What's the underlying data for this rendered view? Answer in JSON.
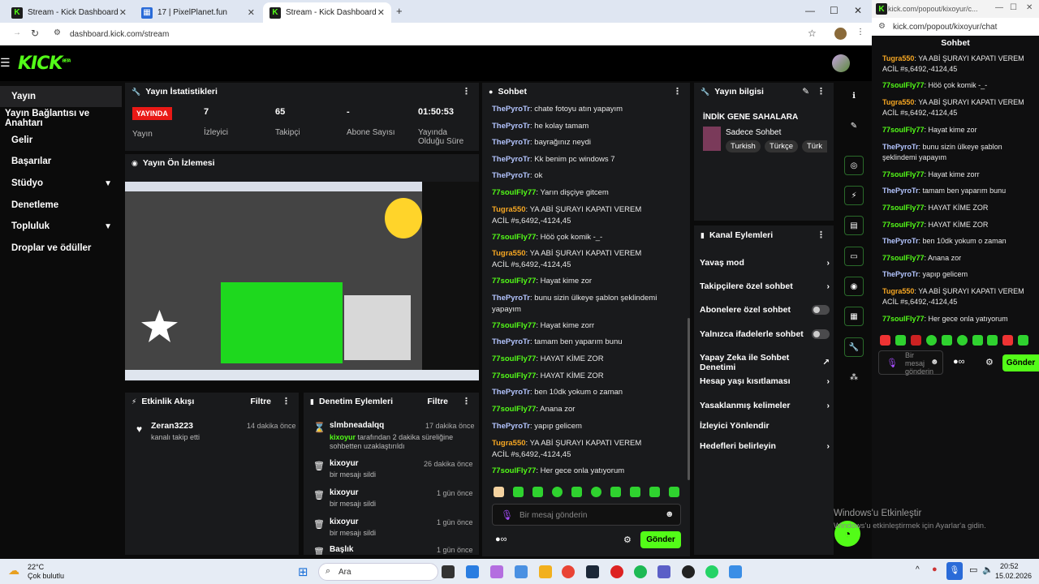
{
  "browser": {
    "tabs": [
      "Stream - Kick Dashboard",
      "17 | PixelPlanet.fun",
      "Stream - Kick Dashboard"
    ],
    "new_tab": "+",
    "url": "dashboard.kick.com/stream",
    "window_controls": [
      "—",
      "☐",
      "✕"
    ]
  },
  "header": {
    "logo": "KICK",
    "logo_sup": "BETA"
  },
  "sidebar": {
    "items": [
      {
        "label": "Yayın"
      },
      {
        "label": "Yayın Bağlantısı ve Anahtarı"
      },
      {
        "label": "Gelir"
      },
      {
        "label": "Başarılar"
      },
      {
        "label": "Stüdyo"
      },
      {
        "label": "Denetleme"
      },
      {
        "label": "Topluluk"
      },
      {
        "label": "Droplar ve ödüller"
      }
    ]
  },
  "stats": {
    "title": "Yayın İstatistikleri",
    "live": "YAYINDA",
    "stream_label": "Yayın",
    "viewers_value": "7",
    "viewers_label": "İzleyici",
    "followers_value": "65",
    "followers_label": "Takipçi",
    "subs_value": "-",
    "subs_label": "Abone Sayısı",
    "uptime_value": "01:50:53",
    "uptime_label": "Yayında Olduğu Süre"
  },
  "preview": {
    "title": "Yayın Ön İzlemesi"
  },
  "activity": {
    "title": "Etkinlik Akışı",
    "filter": "Filtre",
    "item": {
      "user": "Zeran3223",
      "time": "14 dakika önce",
      "text": "kanalı takip etti"
    }
  },
  "moderation": {
    "title": "Denetim Eylemleri",
    "filter": "Filtre",
    "items": [
      {
        "user": "slmbneadalqq",
        "time": "17 dakika önce",
        "actor": "kixoyur",
        "text": "tarafından 2 dakika süreliğine sohbetten uzaklaştırıldı"
      },
      {
        "user": "kixoyur",
        "time": "26 dakika önce",
        "text": "bir mesajı sildi"
      },
      {
        "user": "kixoyur",
        "time": "1 gün önce",
        "text": "bir mesajı sildi"
      },
      {
        "user": "kixoyur",
        "time": "1 gün önce",
        "text": "bir mesajı sildi"
      },
      {
        "user": "Başlık",
        "time": "1 gün önce",
        "text": ""
      }
    ]
  },
  "chat": {
    "title": "Sohbet",
    "messages": [
      {
        "user": "ThePyroTr",
        "text": "chate fotoyu atın yapayım"
      },
      {
        "user": "ThePyroTr",
        "text": "he kolay tamam"
      },
      {
        "user": "ThePyroTr",
        "text": "bayrağınız neydi"
      },
      {
        "user": "ThePyroTr",
        "text": "Kk benim pc windows 7"
      },
      {
        "user": "ThePyroTr",
        "text": "ok"
      },
      {
        "user": "77soulFly77",
        "text": "Yarın dişçiye gitcem"
      },
      {
        "user": "Tugra550",
        "text": "YA ABİ ŞURAYI KAPATI VEREM ACİL #s,6492,-4124,45"
      },
      {
        "user": "77soulFly77",
        "text": "Höö çok komik -_-"
      },
      {
        "user": "Tugra550",
        "text": "YA ABİ ŞURAYI KAPATI VEREM ACİL #s,6492,-4124,45"
      },
      {
        "user": "77soulFly77",
        "text": "Hayat kime zor"
      },
      {
        "user": "ThePyroTr",
        "text": "bunu sizin ülkeye şablon şeklindemi yapayım"
      },
      {
        "user": "77soulFly77",
        "text": "Hayat kime zorr"
      },
      {
        "user": "ThePyroTr",
        "text": "tamam ben yaparım bunu"
      },
      {
        "user": "77soulFly77",
        "text": "HAYAT KİME ZOR"
      },
      {
        "user": "77soulFly77",
        "text": "HAYAT KİME ZOR"
      },
      {
        "user": "ThePyroTr",
        "text": "ben 10dk yokum o zaman"
      },
      {
        "user": "77soulFly77",
        "text": "Anana zor"
      },
      {
        "user": "ThePyroTr",
        "text": "yapıp gelicem"
      },
      {
        "user": "Tugra550",
        "text": "YA ABİ ŞURAYI KAPATI VEREM ACİL #s,6492,-4124,45"
      },
      {
        "user": "77soulFly77",
        "text": "Her gece onla yatıyorum"
      }
    ],
    "placeholder": "Bir mesaj gönderin",
    "send": "Gönder"
  },
  "stream_info": {
    "title": "Yayın bilgisi",
    "stream_title": "İNDİK GENE SAHALARA",
    "category": "Sadece Sohbet",
    "tags": [
      "Turkish",
      "Türkçe",
      "Türk"
    ]
  },
  "channel_actions": {
    "title": "Kanal Eylemleri",
    "items": [
      {
        "label": "Yavaş mod",
        "kind": "chevron"
      },
      {
        "label": "Takipçilere özel sohbet",
        "kind": "chevron"
      },
      {
        "label": "Abonelere özel sohbet",
        "kind": "toggle"
      },
      {
        "label": "Yalnızca ifadelerle sohbet",
        "kind": "toggle"
      },
      {
        "label": "Yapay Zeka ile Sohbet Denetimi",
        "kind": "external"
      },
      {
        "label": "Hesap yaşı kısıtlaması",
        "kind": "chevron"
      },
      {
        "label": "Yasaklanmış kelimeler",
        "kind": "chevron"
      },
      {
        "label": "İzleyici Yönlendir",
        "kind": "none"
      },
      {
        "label": "Hedefleri belirleyin",
        "kind": "chevron"
      }
    ]
  },
  "popout": {
    "url": "kick.com/popout/kixoyur/chat",
    "tab_title": "kick.com/popout/kixoyur/c...",
    "title": "Sohbet",
    "messages": [
      {
        "user": "Tugra550",
        "text": "YA ABİ ŞURAYI KAPATI VEREM ACİL #s,6492,-4124,45"
      },
      {
        "user": "77soulFly77",
        "text": "Höö çok komik -_-"
      },
      {
        "user": "Tugra550",
        "text": "YA ABİ ŞURAYI KAPATI VEREM ACİL #s,6492,-4124,45"
      },
      {
        "user": "77soulFly77",
        "text": "Hayat kime zor"
      },
      {
        "user": "ThePyroTr",
        "text": "bunu sizin ülkeye şablon şeklindemi yapayım"
      },
      {
        "user": "77soulFly77",
        "text": "Hayat kime zorr"
      },
      {
        "user": "ThePyroTr",
        "text": "tamam ben yaparım bunu"
      },
      {
        "user": "77soulFly77",
        "text": "HAYAT KİME ZOR"
      },
      {
        "user": "77soulFly77",
        "text": "HAYAT KİME ZOR"
      },
      {
        "user": "ThePyroTr",
        "text": "ben 10dk yokum o zaman"
      },
      {
        "user": "77soulFly77",
        "text": "Anana zor"
      },
      {
        "user": "ThePyroTr",
        "text": "yapıp gelicem"
      },
      {
        "user": "Tugra550",
        "text": "YA ABİ ŞURAYI KAPATI VEREM ACİL #s,6492,-4124,45"
      },
      {
        "user": "77soulFly77",
        "text": "Her gece onla yatıyorum"
      }
    ],
    "placeholder": "Bir mesaj gönderin",
    "send": "Gönder"
  },
  "watermark": {
    "line1": "Windows'u Etkinleştir",
    "line2": "Windows'u etkinleştirmek için Ayarlar'a gidin."
  },
  "taskbar": {
    "weather_temp": "22°C",
    "weather_text": "Çok bulutlu",
    "search": "Ara",
    "time": "20:52",
    "date": "15.02.2026"
  },
  "colors": {
    "brand": "#53fc18",
    "live": "#e91916",
    "panel": "#191a1c"
  }
}
